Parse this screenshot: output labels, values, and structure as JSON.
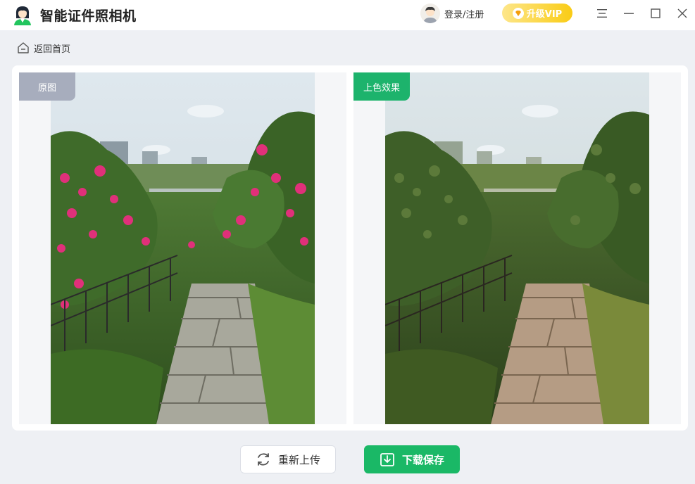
{
  "app": {
    "title": "智能证件照相机"
  },
  "header": {
    "user_label": "登录/注册",
    "vip_label": "升级VIP"
  },
  "nav": {
    "back_label": "返回首页"
  },
  "panels": {
    "original_tag": "原图",
    "colorized_tag": "上色效果"
  },
  "actions": {
    "reupload_label": "重新上传",
    "download_label": "下载保存"
  },
  "colors": {
    "accent_green": "#1ab866",
    "vip_gold": "#facc15",
    "tag_gray": "#a7adbd",
    "background": "#eef0f4"
  }
}
